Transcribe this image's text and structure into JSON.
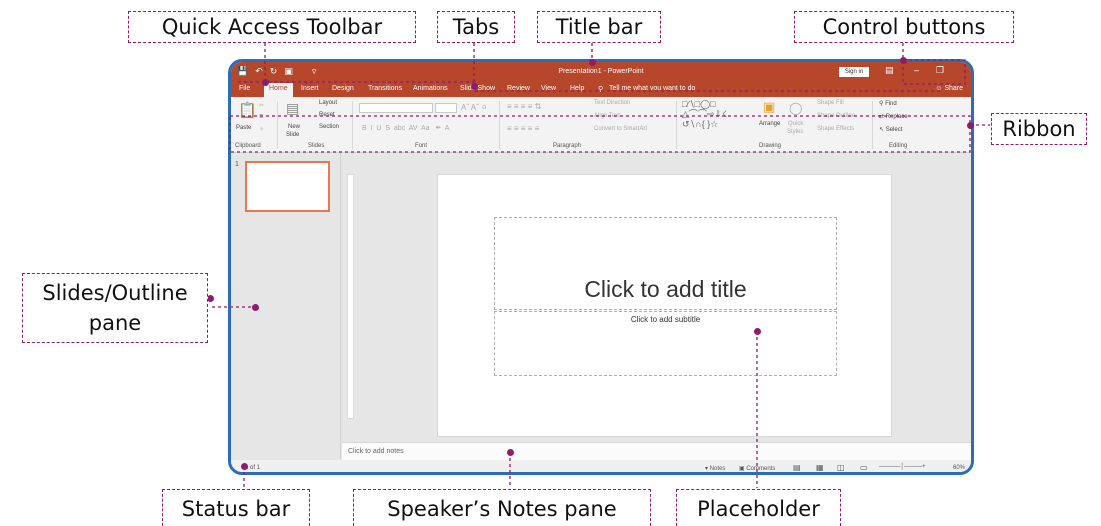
{
  "callouts": {
    "quick_access_toolbar": "Quick Access Toolbar",
    "tabs": "Tabs",
    "title_bar": "Title bar",
    "control_buttons": "Control buttons",
    "ribbon": "Ribbon",
    "slides_outline_line1": "Slides/Outline",
    "slides_outline_line2": "pane",
    "status_bar": "Status bar",
    "speakers_notes_pane": "Speaker’s Notes pane",
    "placeholder": "Placeholder"
  },
  "app": {
    "window_title": "Presentation1 - PowerPoint",
    "sign_in": "Sign in",
    "tabs": [
      "File",
      "Home",
      "Insert",
      "Design",
      "Transitions",
      "Animations",
      "Slide Show",
      "Review",
      "View",
      "Help"
    ],
    "tell_me": "Tell me what you want to do",
    "share": "Share"
  },
  "ribbon": {
    "clipboard": {
      "label": "Clipboard",
      "paste": "Paste"
    },
    "slides": {
      "label": "Slides",
      "new_slide_1": "New",
      "new_slide_2": "Slide",
      "layout": "Layout",
      "reset": "Reset",
      "section": "Section"
    },
    "font": {
      "label": "Font"
    },
    "paragraph": {
      "label": "Paragraph",
      "text_direction": "Text Direction",
      "align_text": "Align Text",
      "convert_smartart": "Convert to SmartArt"
    },
    "drawing": {
      "label": "Drawing",
      "arrange": "Arrange",
      "quick_styles_1": "Quick",
      "quick_styles_2": "Styles",
      "shape_fill": "Shape Fill",
      "shape_outline": "Shape Outline",
      "shape_effects": "Shape Effects"
    },
    "editing": {
      "label": "Editing",
      "find": "Find",
      "replace": "Replace",
      "select": "Select"
    }
  },
  "slides_pane": {
    "slide_number": "1"
  },
  "slide": {
    "title_placeholder": "Click to add title",
    "subtitle_placeholder": "Click to add subtitle"
  },
  "notes": {
    "placeholder": "Click to add notes"
  },
  "status": {
    "slide_count": "1 of 1",
    "notes": "Notes",
    "comments": "Comments",
    "zoom": "60%"
  }
}
